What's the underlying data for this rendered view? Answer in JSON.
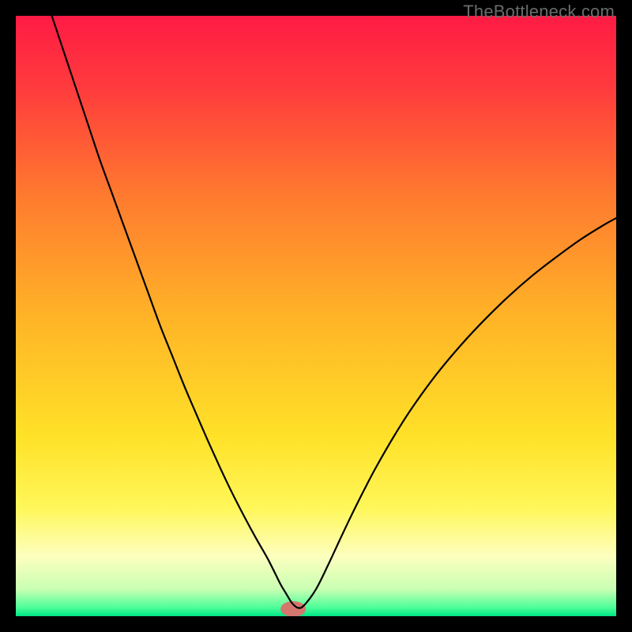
{
  "watermark": "TheBottleneck.com",
  "chart_data": {
    "type": "line",
    "title": "",
    "xlabel": "",
    "ylabel": "",
    "xlim": [
      0,
      100
    ],
    "ylim": [
      0,
      100
    ],
    "background_gradient": {
      "stops": [
        {
          "offset": 0.0,
          "color": "#ff1b44"
        },
        {
          "offset": 0.12,
          "color": "#ff3b3d"
        },
        {
          "offset": 0.3,
          "color": "#ff7a2f"
        },
        {
          "offset": 0.5,
          "color": "#ffb327"
        },
        {
          "offset": 0.7,
          "color": "#ffe128"
        },
        {
          "offset": 0.82,
          "color": "#fff75a"
        },
        {
          "offset": 0.9,
          "color": "#fdffbe"
        },
        {
          "offset": 0.955,
          "color": "#c9ffb3"
        },
        {
          "offset": 0.985,
          "color": "#4fff9a"
        },
        {
          "offset": 1.0,
          "color": "#00e585"
        }
      ]
    },
    "marker": {
      "x": 46.2,
      "y": 1.2,
      "rx": 2.1,
      "ry": 1.3,
      "color": "#d4776e"
    },
    "series": [
      {
        "name": "curve",
        "color": "#000000",
        "width": 2.2,
        "x": [
          6.0,
          8.0,
          10.0,
          12.0,
          14.0,
          16.0,
          18.0,
          20.0,
          22.0,
          24.0,
          26.0,
          28.0,
          30.0,
          32.0,
          34.0,
          36.0,
          38.0,
          40.0,
          42.0,
          44.0,
          45.0,
          46.0,
          47.0,
          48.0,
          50.0,
          52.0,
          54.0,
          56.0,
          58.0,
          60.0,
          63.0,
          66.0,
          70.0,
          74.0,
          78.0,
          82.0,
          86.0,
          90.0,
          94.0,
          98.0,
          100.0
        ],
        "y": [
          100.0,
          94.0,
          88.0,
          82.0,
          76.0,
          70.5,
          65.0,
          59.5,
          54.0,
          48.5,
          43.5,
          38.5,
          33.8,
          29.2,
          24.8,
          20.6,
          16.7,
          13.0,
          9.5,
          5.5,
          3.8,
          2.2,
          1.4,
          1.8,
          4.5,
          8.5,
          12.8,
          17.0,
          21.0,
          24.8,
          30.0,
          34.7,
          40.2,
          45.0,
          49.3,
          53.2,
          56.7,
          59.8,
          62.7,
          65.2,
          66.3
        ]
      }
    ]
  }
}
